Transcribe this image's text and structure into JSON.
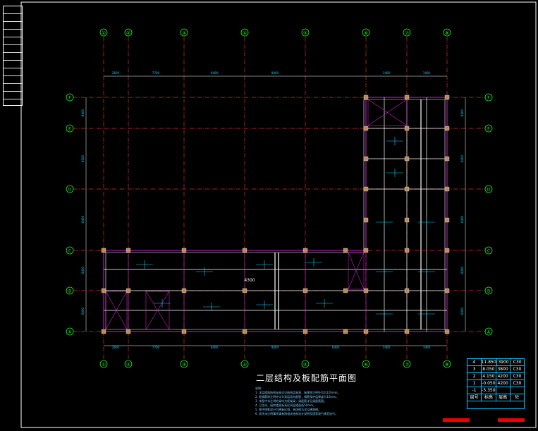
{
  "drawing": {
    "title": "二层结构及板配筋平面图",
    "axes_x": [
      "①",
      "②",
      "③",
      "④",
      "⑤",
      "⑥",
      "⑦",
      "⑧"
    ],
    "axes_y": [
      "A",
      "B",
      "C",
      "D",
      "E",
      "F"
    ],
    "dim_top": [
      "2600",
      "7700",
      "8400",
      "8400",
      "3400",
      "3400"
    ],
    "dim_bottom": [
      "2600",
      "7700",
      "8400",
      "8400",
      "8400",
      "3400",
      "3400"
    ],
    "dim_left": [
      "6000",
      "8400",
      "8400",
      "6000",
      "8400"
    ],
    "dim_right": [
      "6000",
      "8400",
      "8400",
      "6000",
      "8400"
    ],
    "slab_label": "4300",
    "notes": [
      "说明：",
      "1. 本层楼面结构标高详见结构层高表，板厚除注明外均为120mm。",
      "2. 板钢筋除注明外均为双层双向配筋，钢筋保护层厚度为15mm。",
      "3. 本图中未注明的梁均为框架梁，梁配筋详见梁配筋图。",
      "4. 卫生间、厨房楼面标高比同层楼面低50mm。",
      "5. 图中阴影部分为降板区域，具体做法详见建筑图。",
      "6. 其余未注明事项请参照相关结构设计说明及国家现行规范执行。"
    ]
  },
  "legend": {
    "rows": [
      [
        "4",
        "11.850",
        "3900",
        "C30"
      ],
      [
        "3",
        "8.050",
        "3800",
        "C30"
      ],
      [
        "2",
        "4.150",
        "4200",
        "C30"
      ],
      [
        "1",
        "-0.050",
        "4200",
        "C30"
      ],
      [
        "-1",
        "-5.350",
        "",
        ""
      ],
      [
        "层号",
        "标高",
        "层高",
        "砼"
      ]
    ]
  },
  "colors": {
    "axis": "#e03030",
    "axis_label": "#22ee22",
    "beam": "#cc22cc",
    "wall": "#ffffff",
    "column": "#b98a5a",
    "text": "#00d8ff"
  }
}
